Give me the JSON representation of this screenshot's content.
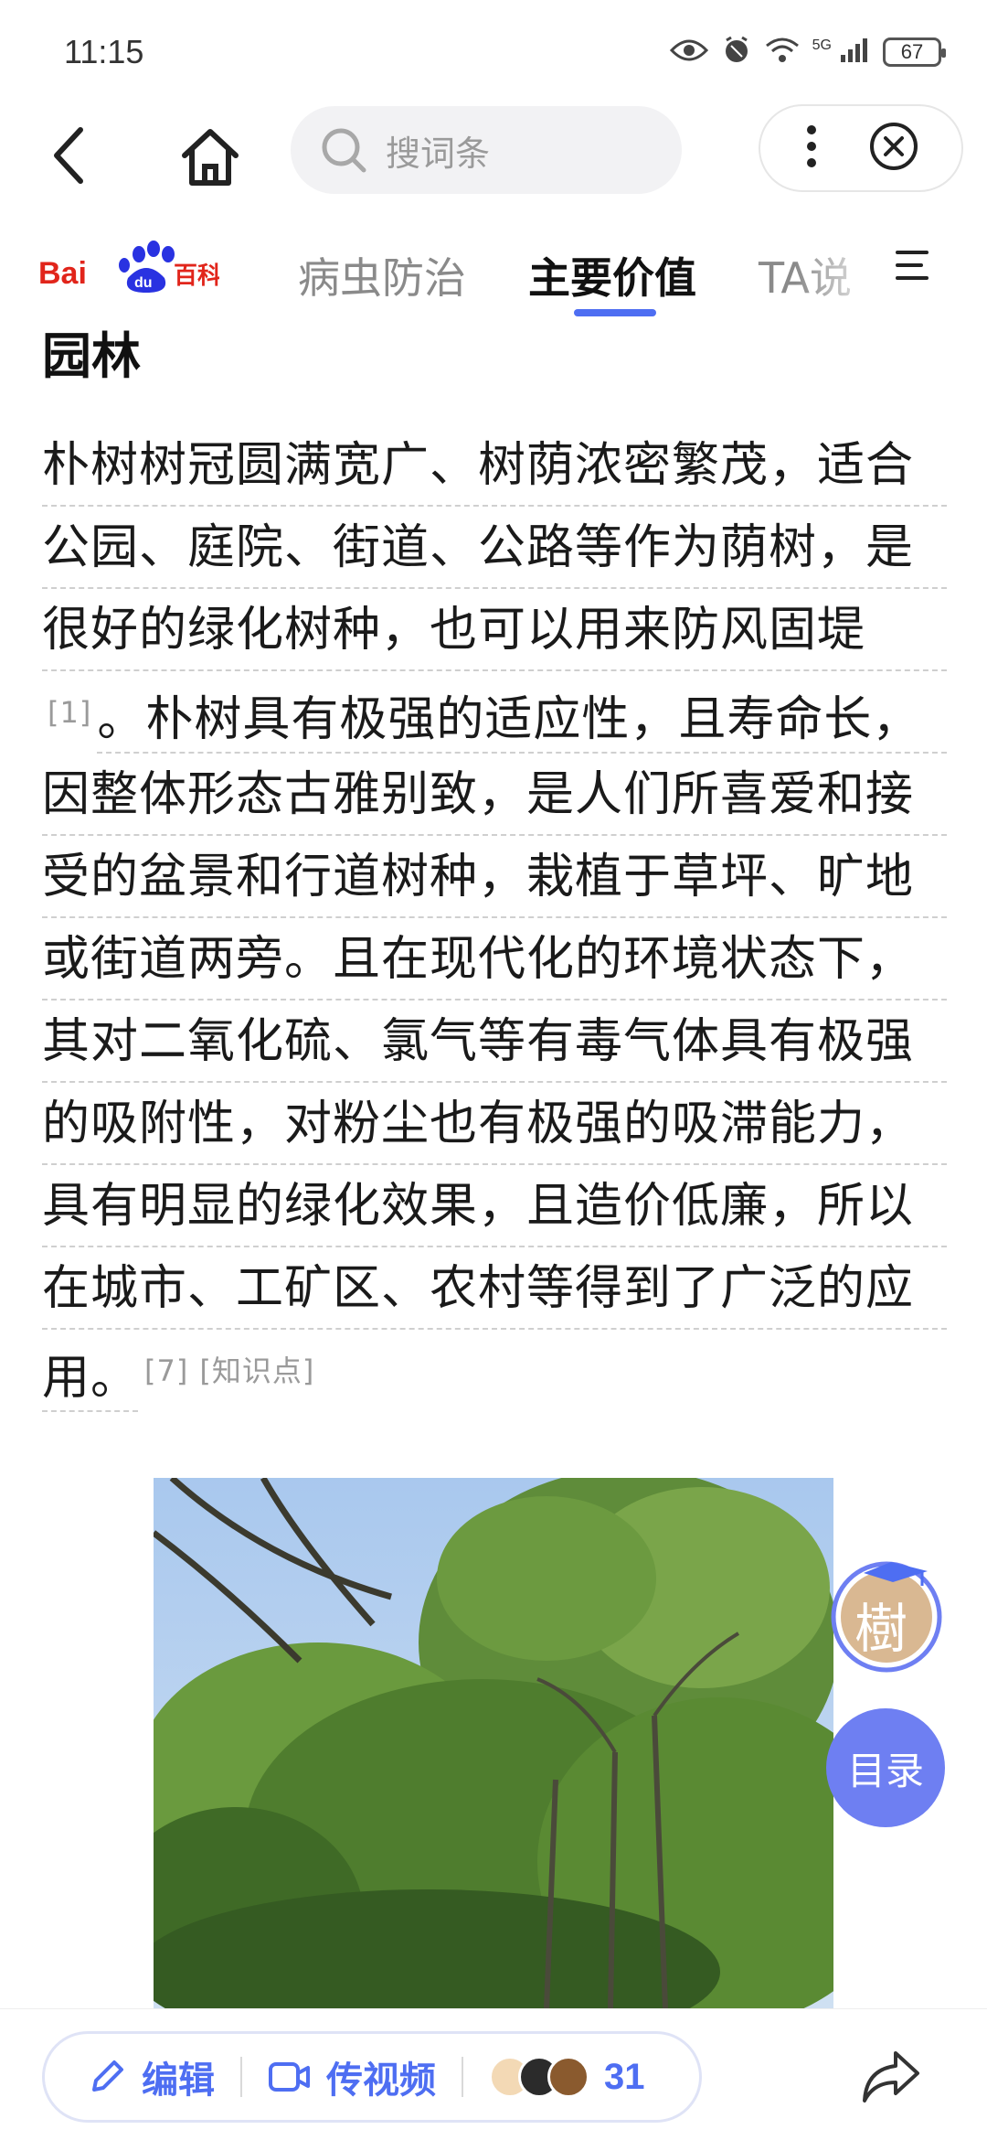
{
  "status_bar": {
    "time": "11:15",
    "network": "5G",
    "battery": "67",
    "icons": [
      "eye-icon",
      "alarm-icon",
      "wifi-icon",
      "signal-icon",
      "battery-icon"
    ]
  },
  "top_bar": {
    "search_placeholder": "搜词条",
    "icons": [
      "back-icon",
      "home-icon",
      "search-icon",
      "more-icon",
      "close-icon"
    ]
  },
  "tabs": {
    "items": [
      "病虫防治",
      "主要价值",
      "TA说"
    ],
    "active": "主要价值",
    "brand_logo": "Baidu百科",
    "accent_color": "#4e6ef2"
  },
  "content": {
    "section_title": "园林",
    "lines": [
      "朴树树冠圆满宽广、树荫浓密繁茂，适合",
      "公园、庭院、街道、公路等作为荫树，是",
      "很好的绿化树种，也可以用来防风固堤",
      "。朴树具有极强的适应性，且寿命长，",
      "因整体形态古雅别致，是人们所喜爱和接",
      "受的盆景和行道树种，栽植于草坪、旷地",
      "或街道两旁。且在现代化的环境状态下，",
      "其对二氧化硫、氯气等有毒气体具有极强",
      "的吸附性，对粉尘也有极强的吸滞能力，",
      "具有明显的绿化效果，且造价低廉，所以",
      "在城市、工矿区、农村等得到了广泛的应",
      "用。"
    ],
    "ref1": "[1]",
    "ref7": "[7]",
    "knowledge_tag": "[知识点]"
  },
  "floating": {
    "avatar_char": "樹",
    "toc_label": "目录"
  },
  "bottom_bar": {
    "edit_label": "编辑",
    "video_label": "传视频",
    "count": "31"
  }
}
